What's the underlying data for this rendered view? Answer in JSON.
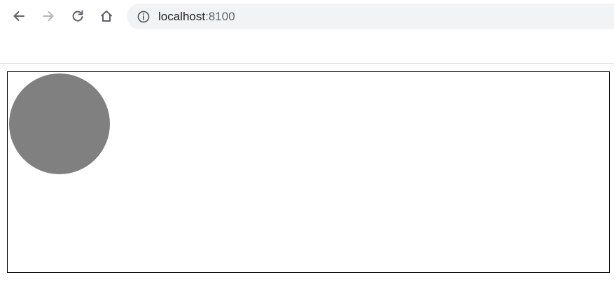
{
  "browser": {
    "url_host": "localhost",
    "url_port": ":8100",
    "icons": {
      "back": "back-arrow-icon",
      "forward": "forward-arrow-icon",
      "reload": "reload-icon",
      "home": "home-icon",
      "info": "info-icon"
    }
  },
  "canvas": {
    "border_color": "#000000",
    "background": "#ffffff",
    "ball_color": "#808080"
  }
}
